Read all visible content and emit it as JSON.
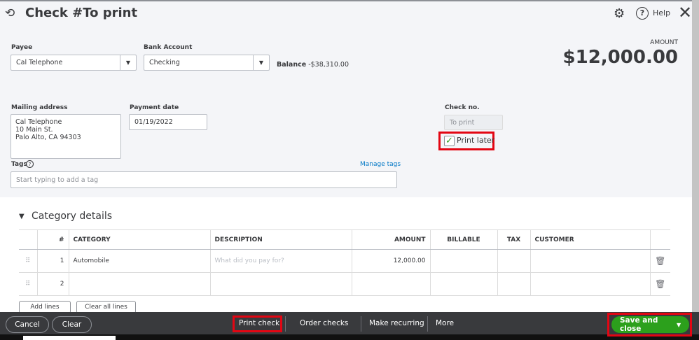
{
  "header": {
    "title": "Check #To print",
    "help": "Help"
  },
  "payee": {
    "label": "Payee",
    "value": "Cal Telephone"
  },
  "bank": {
    "label": "Bank Account",
    "value": "Checking",
    "balance_label": "Balance",
    "balance": "-$38,310.00"
  },
  "amount": {
    "label": "AMOUNT",
    "value": "$12,000.00"
  },
  "mailing": {
    "label": "Mailing address",
    "lines": [
      "Cal Telephone",
      "10 Main St.",
      "Palo Alto, CA  94303"
    ]
  },
  "payment_date": {
    "label": "Payment date",
    "value": "01/19/2022"
  },
  "check_no": {
    "label": "Check no.",
    "placeholder": "To print"
  },
  "print_later": {
    "label": "Print later",
    "checked": true
  },
  "tags": {
    "label": "Tags",
    "manage": "Manage tags",
    "placeholder": "Start typing to add a tag"
  },
  "category": {
    "title": "Category details",
    "headers": [
      "#",
      "CATEGORY",
      "DESCRIPTION",
      "AMOUNT",
      "BILLABLE",
      "TAX",
      "CUSTOMER"
    ],
    "rows": [
      {
        "num": "1",
        "category": "Automobile",
        "description_placeholder": "What did you pay for?",
        "amount": "12,000.00"
      },
      {
        "num": "2",
        "category": "",
        "description_placeholder": "",
        "amount": ""
      }
    ],
    "add_lines": "Add lines",
    "clear_lines": "Clear all lines"
  },
  "footer": {
    "cancel": "Cancel",
    "clear": "Clear",
    "print_check": "Print check",
    "order_checks": "Order checks",
    "make_recurring": "Make recurring",
    "more": "More",
    "save_close": "Save and close"
  }
}
